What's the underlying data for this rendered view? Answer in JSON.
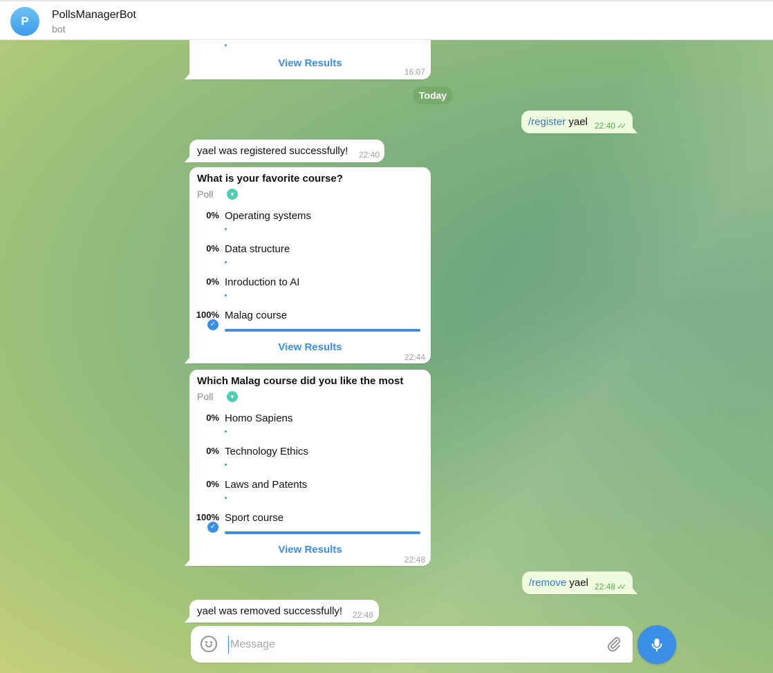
{
  "header": {
    "avatar_letter": "P",
    "title": "PollsManagerBot",
    "subtitle": "bot"
  },
  "messages": {
    "prev_poll": {
      "view_results": "View Results",
      "time": "16:07"
    },
    "date_separator": "Today",
    "register_cmd": {
      "command": "/register",
      "arg": "yael",
      "time": "22:40"
    },
    "register_reply": {
      "text": "yael was registered successfully!",
      "time": "22:40"
    },
    "poll1": {
      "question": "What is your favorite course?",
      "type": "Poll",
      "options": [
        {
          "pct": "0%",
          "label": "Operating systems",
          "fraction": 0
        },
        {
          "pct": "0%",
          "label": "Data structure",
          "fraction": 0
        },
        {
          "pct": "0%",
          "label": "Inroduction to AI",
          "fraction": 0
        },
        {
          "pct": "100%",
          "label": "Malag course",
          "fraction": 1,
          "voted": true
        }
      ],
      "view_results": "View Results",
      "time": "22:44"
    },
    "poll2": {
      "question": "Which Malag course did you like the most",
      "type": "Poll",
      "options": [
        {
          "pct": "0%",
          "label": "Homo Sapiens",
          "fraction": 0
        },
        {
          "pct": "0%",
          "label": "Technology Ethics",
          "fraction": 0
        },
        {
          "pct": "0%",
          "label": "Laws and Patents",
          "fraction": 0
        },
        {
          "pct": "100%",
          "label": "Sport course",
          "fraction": 1,
          "voted": true
        }
      ],
      "view_results": "View Results",
      "time": "22:48"
    },
    "remove_cmd": {
      "command": "/remove",
      "arg": "yael",
      "time": "22:48"
    },
    "remove_reply": {
      "text": "yael was removed successfully!",
      "time": "22:48"
    }
  },
  "composer": {
    "placeholder": "Message",
    "value": ""
  },
  "colors": {
    "accent": "#3a8ee6",
    "outgoing_bubble": "#effdde",
    "read_check": "#4fae4e"
  },
  "icons": {
    "emoji": "smile-icon",
    "attach": "paperclip-icon",
    "mic": "microphone-icon",
    "voted": "check-icon",
    "read": "double-check-icon"
  }
}
